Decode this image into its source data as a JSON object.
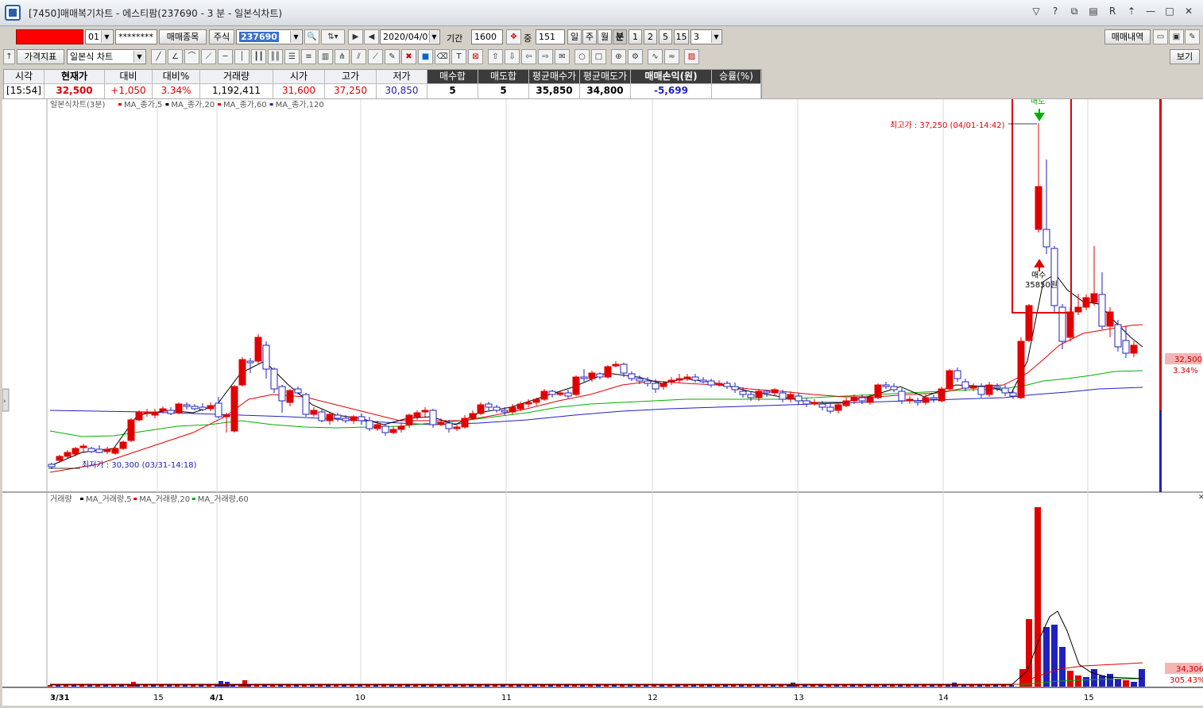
{
  "window": {
    "title": "[7450]매매복기차트 - 에스티팜(237690 - 3 분 - 일본식차트)"
  },
  "toolbar1": {
    "account_suffix": "01",
    "password_mask": "********",
    "stock_select_label": "매매종목",
    "market_type": "주식",
    "stock_code": "237690",
    "date": "2020/04/01",
    "period_label": "기간",
    "period_value": "1600",
    "count_label": "중",
    "count_value": "151",
    "period_buttons": [
      "일",
      "주",
      "월",
      "분",
      "1",
      "2",
      "5",
      "15"
    ],
    "minute_value": "3",
    "trade_history_label": "매매내역"
  },
  "toolbar2": {
    "indicator_label": "가격지표",
    "chart_type_value": "일본식 차트",
    "view_label": "보기"
  },
  "quote": {
    "headers": [
      "시각",
      "현재가",
      "대비",
      "대비%",
      "거래량",
      "시가",
      "고가",
      "저가",
      "매수합",
      "매도합",
      "평균매수가",
      "평균매도가",
      "매매손익(원)",
      "승률(%)"
    ],
    "values": [
      "[15:54]",
      "32,500",
      "+1,050",
      "3.34%",
      "1,192,411",
      "31,600",
      "37,250",
      "30,850",
      "5",
      "5",
      "35,850",
      "34,800",
      "-5,699",
      ""
    ]
  },
  "price_panel": {
    "legend_title": "일본식차트(3분)",
    "legend_items": [
      {
        "label": "MA_종가,5",
        "color": "#e00000"
      },
      {
        "label": "MA_종가,20",
        "color": "#000000"
      },
      {
        "label": "MA_종가,60",
        "color": "#e00000"
      },
      {
        "label": "MA_종가,120",
        "color": "#2020c0"
      }
    ],
    "high_annotation": "최고가 : 37,250 (04/01-14:42)",
    "low_annotation": "최저가 : 30,300 (03/31-14:18)",
    "sell_marker": "매도",
    "buy_marker": "매수",
    "buy_price_label": "35850원",
    "current_price_tag": "32,500",
    "current_change_tag": "3.34%"
  },
  "volume_panel": {
    "legend_title": "거래량",
    "legend_items": [
      {
        "label": "MA_거래량,5",
        "color": "#000000"
      },
      {
        "label": "MA_거래량,20",
        "color": "#e00000"
      },
      {
        "label": "MA_거래량,60",
        "color": "#00b000"
      }
    ],
    "current_volume_tag": "34,306",
    "volume_ratio_tag": "305.43%"
  },
  "x_axis": {
    "labels": [
      "3/31",
      "15",
      "4/1",
      "10",
      "11",
      "12",
      "13",
      "14",
      "15"
    ]
  },
  "colors": {
    "up": "#e00000",
    "down": "#2020c0",
    "ma5": "#e00000",
    "ma20": "#000000",
    "ma60": "#00b000",
    "ma120": "#2020c0",
    "highlight_box": "#e00000"
  }
}
